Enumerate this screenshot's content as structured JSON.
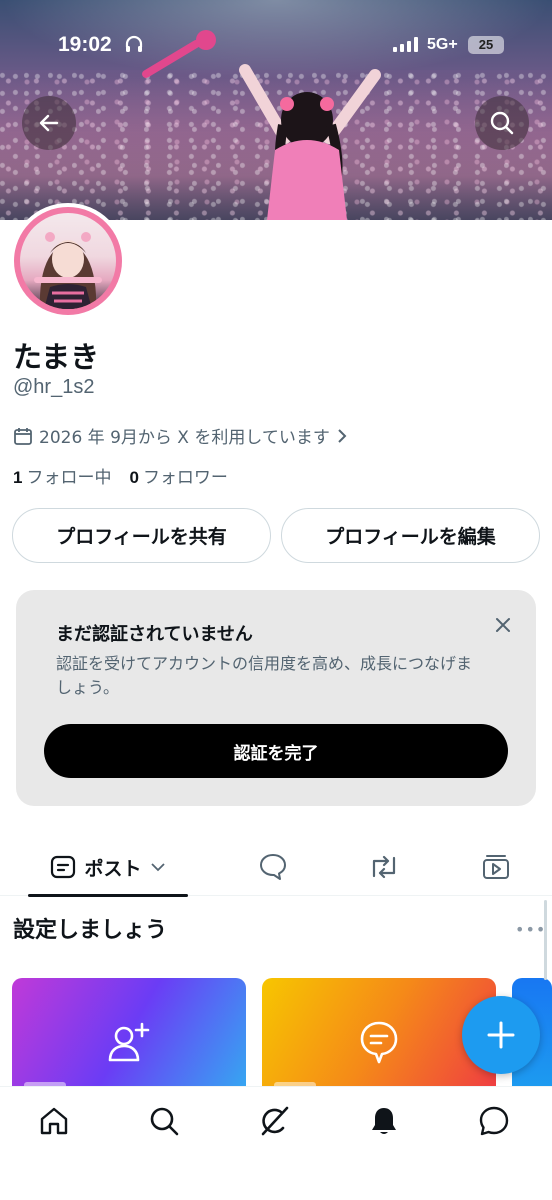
{
  "status_bar": {
    "time": "19:02",
    "network": "5G+",
    "battery": "25"
  },
  "profile": {
    "display_name": "たまき",
    "handle": "@hr_1s2",
    "joined_text": "2026 年 9月から X を利用しています",
    "following_count": "1",
    "following_label": "フォロー中",
    "followers_count": "0",
    "followers_label": "フォロワー"
  },
  "actions": {
    "share_label": "プロフィールを共有",
    "edit_label": "プロフィールを編集"
  },
  "verify_card": {
    "title": "まだ認証されていません",
    "description": "認証を受けてアカウントの信用度を高め、成長につなげましょう。",
    "button_label": "認証を完了"
  },
  "tabs": {
    "posts_label": "ポスト",
    "replies_icon": "speech-bubble-icon",
    "reposts_icon": "repost-icon",
    "media_icon": "video-icon"
  },
  "setup": {
    "title": "設定しましょう",
    "more": "•••"
  },
  "colors": {
    "accent": "#1d9bf0",
    "avatar_ring": "#f27aa6",
    "text_secondary": "#536471",
    "verify_button": "#000000"
  },
  "bottom_nav": [
    "home-icon",
    "search-icon",
    "grok-icon",
    "notifications-icon",
    "messages-icon"
  ]
}
